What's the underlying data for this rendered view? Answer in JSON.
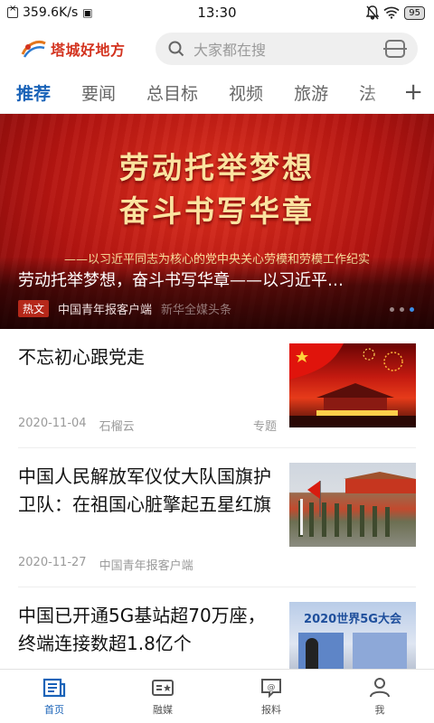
{
  "status_bar": {
    "speed": "359.6K/s",
    "time": "13:30",
    "battery": "95"
  },
  "header": {
    "logo_text": "塔城好地方",
    "search_placeholder": "大家都在搜"
  },
  "tabs": [
    {
      "label": "推荐",
      "active": true
    },
    {
      "label": "要闻"
    },
    {
      "label": "总目标"
    },
    {
      "label": "视频"
    },
    {
      "label": "旅游"
    },
    {
      "label": "法"
    }
  ],
  "banner": {
    "headline_line1": "劳动托举梦想",
    "headline_line2": "奋斗书写华章",
    "subtitle": "——以习近平同志为核心的党中央关心劳模和劳模工作纪实",
    "title": "劳动托举梦想，奋斗书写华章——以习近平…",
    "tag": "热文",
    "source": "中国青年报客户端",
    "watermark": "新华全媒头条",
    "dots": 3,
    "active_dot": 2
  },
  "news": [
    {
      "title": "不忘初心跟党走",
      "date": "2020-11-04",
      "source": "石榴云",
      "tag": "专题"
    },
    {
      "title": "中国人民解放军仪仗大队国旗护卫队：在祖国心脏擎起五星红旗",
      "date": "2020-11-27",
      "source": "中国青年报客户端",
      "tag": ""
    },
    {
      "title": "中国已开通5G基站超70万座，终端连接数超1.8亿个",
      "date": "",
      "source": "",
      "tag": "",
      "thumb_text": "2020世界5G大会"
    }
  ],
  "bottom_nav": [
    {
      "label": "首页",
      "icon": "news-icon",
      "active": true
    },
    {
      "label": "融媒",
      "icon": "media-icon"
    },
    {
      "label": "报料",
      "icon": "report-icon"
    },
    {
      "label": "我",
      "icon": "user-icon"
    }
  ],
  "colors": {
    "accent": "#1a63b8",
    "logo_red": "#d3331f",
    "banner_red": "#c41a10"
  }
}
